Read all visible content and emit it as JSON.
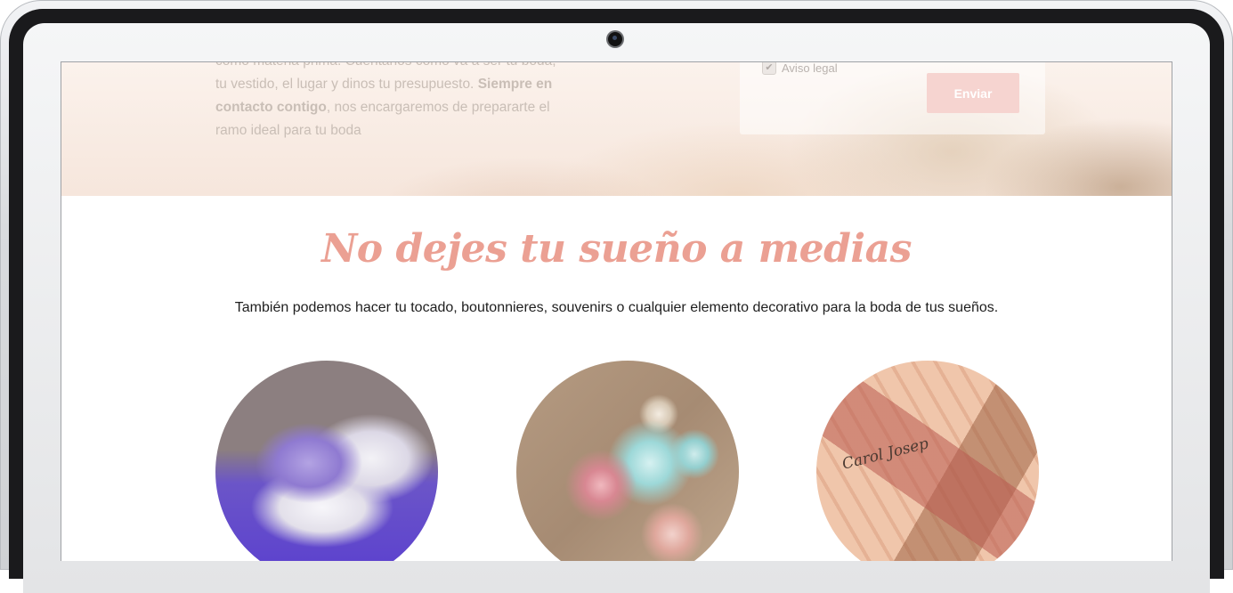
{
  "hero": {
    "line1": "como materia prima. Cuéntanos como va a ser tu boda,",
    "line2": "tu vestido, el lugar y dinos tu presupuesto.",
    "bold1": "Siempre en",
    "bold2": "contacto contigo",
    "line3": ", nos encargaremos de prepararte el",
    "line4": "ramo ideal para tu boda"
  },
  "form": {
    "legal_label": "Aviso legal",
    "legal_checked": true,
    "send_label": "Enviar"
  },
  "section": {
    "title": "No dejes tu sueño a medias",
    "subtitle": "También podemos hacer tu tocado, boutonnieres, souvenirs o cualquier elemento decorativo para la boda de tus sueños."
  },
  "gallery": {
    "items": [
      {
        "icon": "boutonniere-photo"
      },
      {
        "icon": "paper-rosettes-photo"
      },
      {
        "icon": "souvenir-tags-photo",
        "caption": "Carol Josep"
      }
    ]
  },
  "colors": {
    "accent": "#eba093",
    "button": "#f6d4d0",
    "text": "#1e1e1e"
  }
}
